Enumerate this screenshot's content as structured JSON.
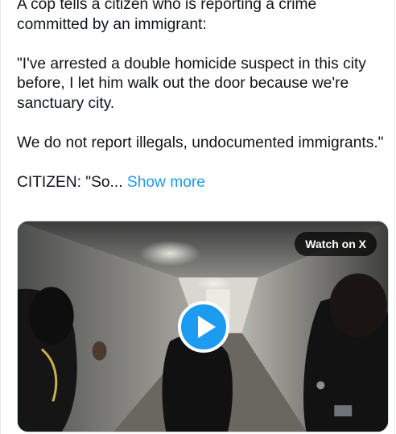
{
  "tweet": {
    "paragraphs": [
      "A cop tells a citizen who is reporting a crime committed by an immigrant:",
      "\"I've arrested a double homicide suspect in this city before, I let him walk out the door because we're sanctuary city.",
      "We do not report illegals, undocumented immigrants.\""
    ],
    "truncated_text": "CITIZEN:  \"So...",
    "show_more_label": "Show more"
  },
  "media": {
    "watch_label": "Watch on X",
    "play_icon": "play-icon",
    "accent_color": "#1d9bf0"
  }
}
